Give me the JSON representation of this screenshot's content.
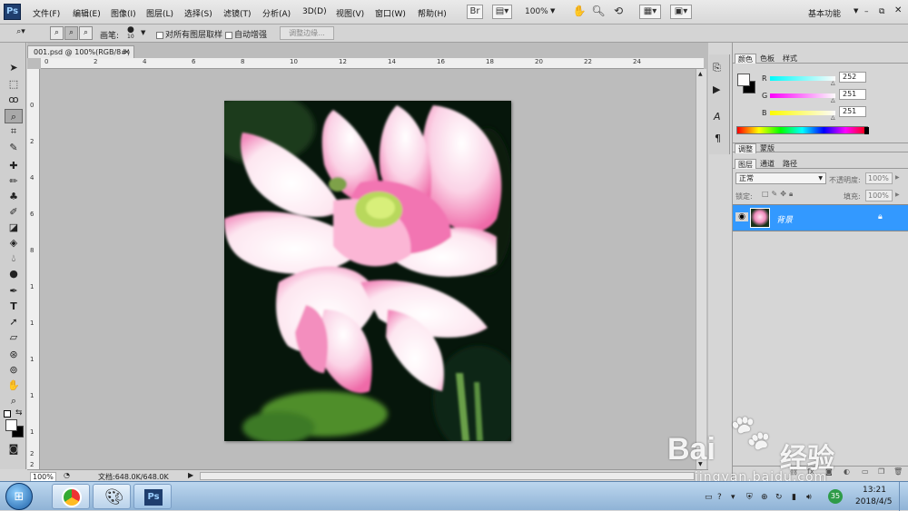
{
  "app": {
    "logo_text": "Ps"
  },
  "menu": [
    "文件(F)",
    "编辑(E)",
    "图像(I)",
    "图层(L)",
    "选择(S)",
    "滤镜(T)",
    "分析(A)",
    "3D(D)",
    "视图(V)",
    "窗口(W)",
    "帮助(H)"
  ],
  "appbar": {
    "zoom": "100%",
    "workspace": "基本功能"
  },
  "options": {
    "brush_label": "画笔:",
    "brush_size": "10",
    "sample_all_layers": "对所有图层取样",
    "auto_enhance": "自动增强",
    "refine_edge": "调整边缘..."
  },
  "document": {
    "tab_title": "001.psd @ 100%(RGB/8#)"
  },
  "ruler_top": [
    "0",
    "2",
    "4",
    "6",
    "8",
    "10",
    "12",
    "14",
    "16",
    "18",
    "20",
    "22",
    "24"
  ],
  "ruler_left": [
    "0",
    "2",
    "4",
    "6",
    "8",
    "1",
    "1",
    "1",
    "1",
    "1",
    "2",
    "2"
  ],
  "status": {
    "zoom": "100%",
    "doc_size": "文档:648.0K/648.0K"
  },
  "color_panel": {
    "tabs": [
      "颜色",
      "色板",
      "样式"
    ],
    "channels": [
      {
        "label": "R",
        "value": "252"
      },
      {
        "label": "G",
        "value": "251"
      },
      {
        "label": "B",
        "value": "251"
      }
    ]
  },
  "adjust_panel": {
    "tabs": [
      "调整",
      "蒙版"
    ]
  },
  "layers_panel": {
    "tabs": [
      "图层",
      "通道",
      "路径"
    ],
    "blend_mode": "正常",
    "opacity_label": "不透明度:",
    "opacity": "100%",
    "lock_label": "锁定:",
    "fill_label": "填充:",
    "fill": "100%",
    "layers": [
      {
        "name": "背景"
      }
    ]
  },
  "taskbar": {
    "time": "13:21",
    "date": "2018/4/5",
    "badge": "35"
  },
  "watermark": {
    "brand": "Bai",
    "brand2": "经验",
    "url": "jingyan.baidu.com"
  },
  "colors": {
    "accent": "#3aa0ff",
    "selection": "#3399ff"
  }
}
